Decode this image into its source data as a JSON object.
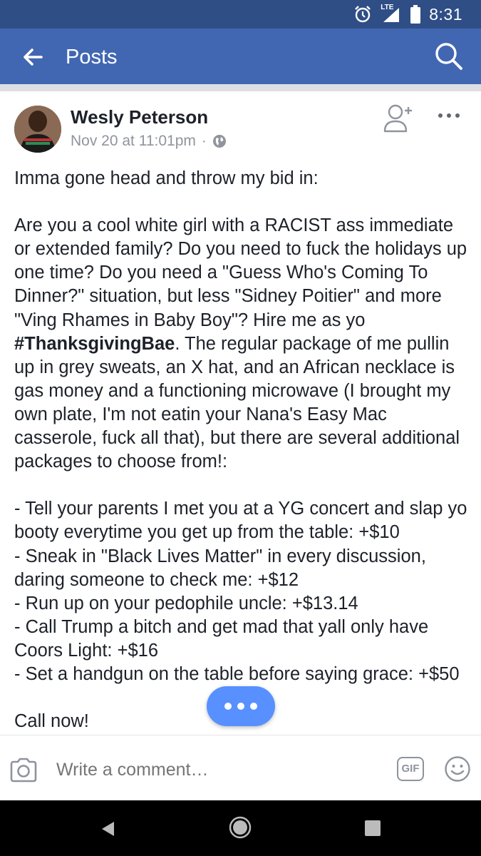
{
  "status_bar": {
    "network": "LTE",
    "time": "8:31"
  },
  "header": {
    "title": "Posts"
  },
  "post": {
    "author": "Wesly Peterson",
    "timestamp": "Nov 20 at 11:01pm",
    "separator": "·",
    "paragraphs": [
      "Imma gone head and throw my bid in:",
      "",
      "Are you a cool white girl with a RACIST ass immediate or extended family? Do you need to fuck the holidays up one time? Do you need a \"Guess Who's Coming To Dinner?\" situation, but less \"Sidney Poitier\" and more \"Ving Rhames in Baby Boy\"? Hire me as yo ",
      "",
      "- Tell your parents I met you at a YG concert and slap yo booty everytime you get up from the table: +$10",
      "- Sneak in \"Black Lives Matter\" in every discussion, daring someone to check me: +$12",
      "- Run up on your pedophile uncle: +$13.14",
      "- Call Trump a bitch and get mad that yall only have Coors Light: +$16",
      "- Set a handgun on the table before saying grace: +$50",
      "",
      "Call now!"
    ],
    "hashtag": "#ThanksgivingBae",
    "after_hashtag": ". The regular package of me pullin up in grey sweats, an X hat, and an African necklace is gas money and a functioning microwave (I brought my own plate, I'm not eatin your Nana's Easy Mac casserole, fuck all that), but there are several additional packages to choose from!:"
  },
  "comment": {
    "placeholder": "Write a comment…",
    "gif_label": "GIF"
  },
  "colors": {
    "header_bg": "#4267b2",
    "status_bg": "#2f4e86",
    "accent": "#5890ff"
  }
}
